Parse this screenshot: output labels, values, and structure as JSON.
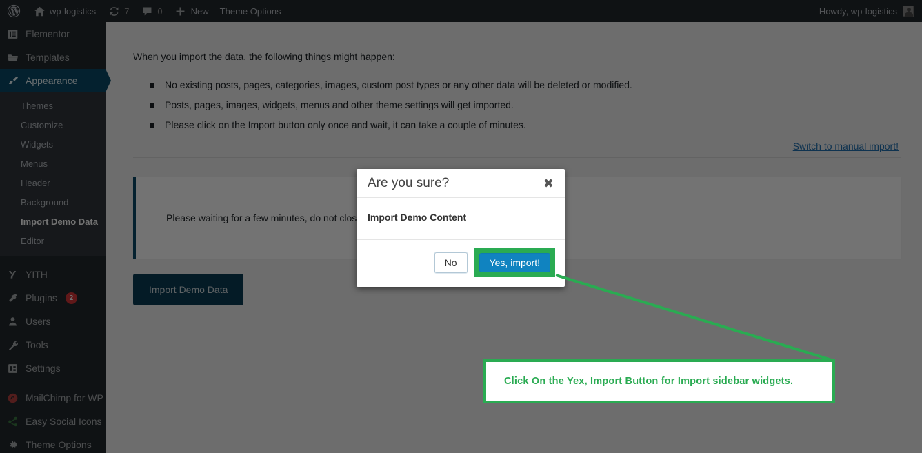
{
  "adminbar": {
    "logo_icon": "wordpress-logo-icon",
    "site_name": "wp-logistics",
    "site_icon": "home-icon",
    "updates_icon": "updates-icon",
    "updates_count": "7",
    "comments_icon": "comment-bubble-icon",
    "comments_count": "0",
    "new_icon": "plus-icon",
    "new_label": "New",
    "theme_options_label": "Theme Options",
    "howdy": "Howdy, wp-logistics",
    "avatar": "avatar"
  },
  "sidebar": {
    "items": [
      {
        "label": "Elementor",
        "icon": "elementor-icon",
        "current": false
      },
      {
        "label": "Templates",
        "icon": "folder-icon",
        "current": false
      },
      {
        "label": "Appearance",
        "icon": "paintbrush-icon",
        "current": true
      }
    ],
    "submenu": [
      {
        "label": "Themes",
        "current": false
      },
      {
        "label": "Customize",
        "current": false
      },
      {
        "label": "Widgets",
        "current": false
      },
      {
        "label": "Menus",
        "current": false
      },
      {
        "label": "Header",
        "current": false
      },
      {
        "label": "Background",
        "current": false
      },
      {
        "label": "Import Demo Data",
        "current": true
      },
      {
        "label": "Editor",
        "current": false
      }
    ],
    "items_lower": [
      {
        "label": "YITH",
        "icon": "yith-icon",
        "badge": ""
      },
      {
        "label": "Plugins",
        "icon": "plug-icon",
        "badge": "2"
      },
      {
        "label": "Users",
        "icon": "user-icon",
        "badge": ""
      },
      {
        "label": "Tools",
        "icon": "wrench-icon",
        "badge": ""
      },
      {
        "label": "Settings",
        "icon": "settings-sliders-icon",
        "badge": ""
      }
    ],
    "items_plugins": [
      {
        "label": "MailChimp for WP",
        "icon": "mailchimp-icon",
        "badge": ""
      },
      {
        "label": "Easy Social Icons",
        "icon": "share-icon",
        "badge": ""
      },
      {
        "label": "Theme Options",
        "icon": "gear-icon",
        "badge": ""
      }
    ]
  },
  "main": {
    "lead": "When you import the data, the following things might happen:",
    "bullets": [
      "No existing posts, pages, categories, images, custom post types or any other data will be deleted or modified.",
      "Posts, pages, images, widgets, menus and other theme settings will get imported.",
      "Please click on the Import button only once and wait, it can take a couple of minutes."
    ],
    "manual_link": "Switch to manual import!",
    "notice_text": "Please waiting for a few minutes, do not close this window until all data is imported.",
    "import_button": "Import Demo Data"
  },
  "modal": {
    "title": "Are you sure?",
    "close_icon": "close-icon",
    "body": "Import Demo Content",
    "no_label": "No",
    "yes_label": "Yes, import!"
  },
  "annotation": {
    "text": "Click On the Yex, Import Button for Import sidebar  widgets.",
    "color": "#2aab52"
  },
  "colors": {
    "admin_dark": "#23282d",
    "submenu_dark": "#32373c",
    "current_blue": "#0a4b68",
    "link_blue": "#2271b1",
    "accent_green": "#2aab52",
    "yes_button_blue": "#1083c0",
    "import_button": "#0a3c54",
    "badge_red": "#d63638"
  }
}
